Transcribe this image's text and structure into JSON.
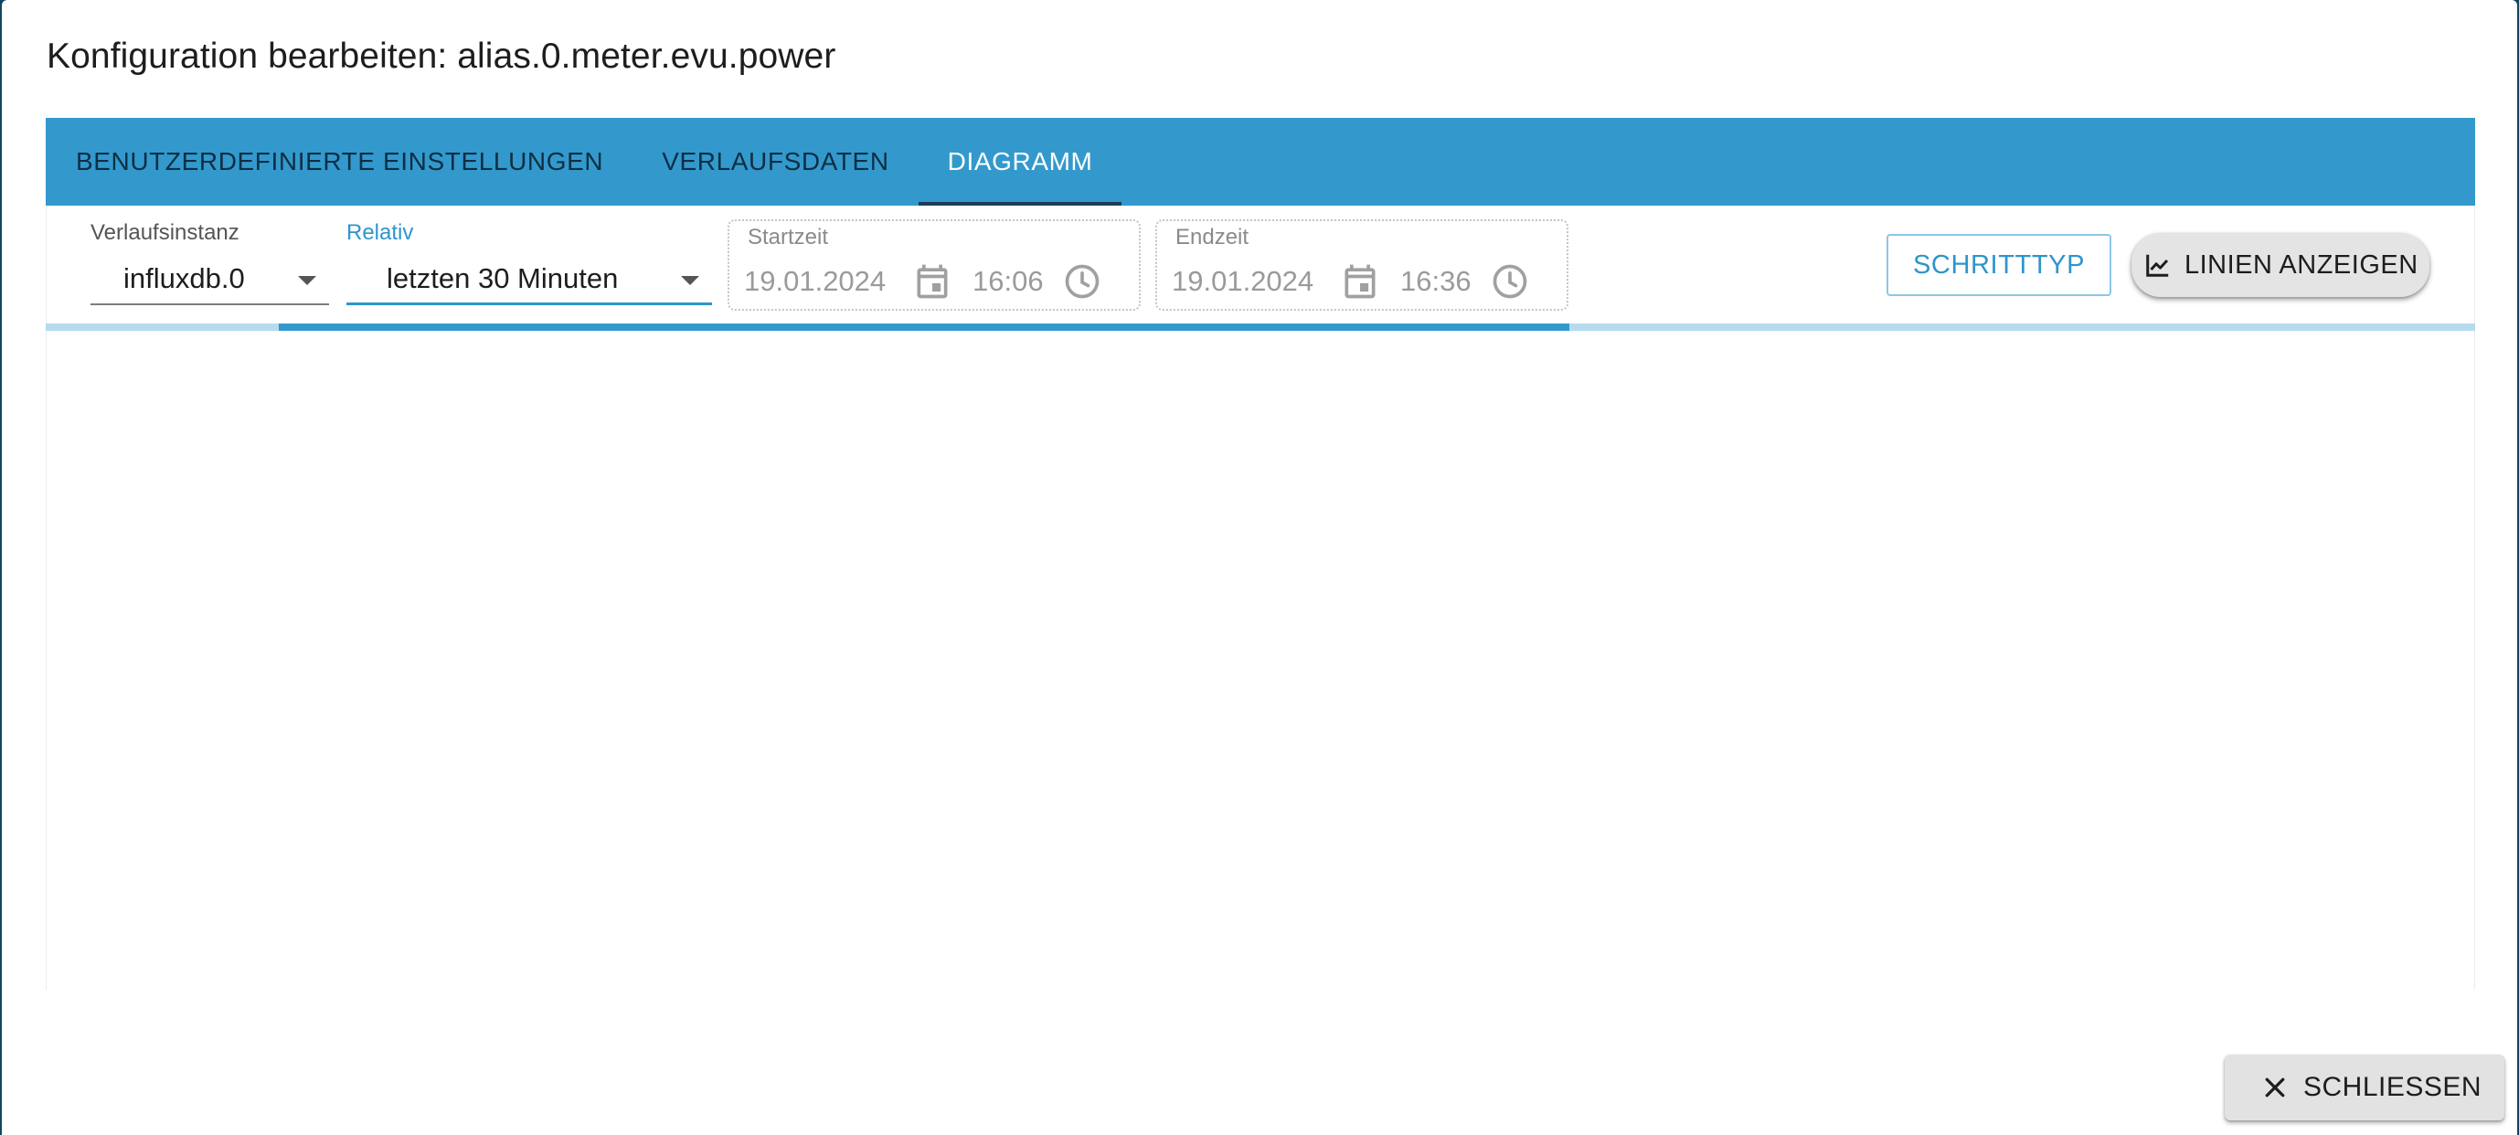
{
  "dialog": {
    "title": "Konfiguration bearbeiten: alias.0.meter.evu.power"
  },
  "tabs": [
    {
      "label": "BENUTZERDEFINIERTE EINSTELLUNGEN",
      "active": false
    },
    {
      "label": "VERLAUFSDATEN",
      "active": false
    },
    {
      "label": "DIAGRAMM",
      "active": true
    }
  ],
  "toolbar": {
    "instance": {
      "label": "Verlaufsinstanz",
      "value": "influxdb.0"
    },
    "relative": {
      "label": "Relativ",
      "value": "letzten 30 Minuten"
    },
    "start": {
      "label": "Startzeit",
      "date": "19.01.2024",
      "time": "16:06"
    },
    "end": {
      "label": "Endzeit",
      "date": "19.01.2024",
      "time": "16:36"
    },
    "step_type_button": "SCHRITTTYP",
    "show_lines_button": "LINIEN ANZEIGEN"
  },
  "loading": {
    "progress_start": 0.096,
    "progress_end": 0.627
  },
  "footer": {
    "close_button": "SCHLIESSEN"
  },
  "colors": {
    "accent": "#3399cc",
    "tab_indicator": "#1b3c58",
    "background": "#14455e"
  },
  "icons": {
    "calendar": "calendar-icon",
    "clock": "clock-icon",
    "chart": "line-chart-icon",
    "close": "close-icon",
    "dropdown": "caret-down-icon"
  }
}
